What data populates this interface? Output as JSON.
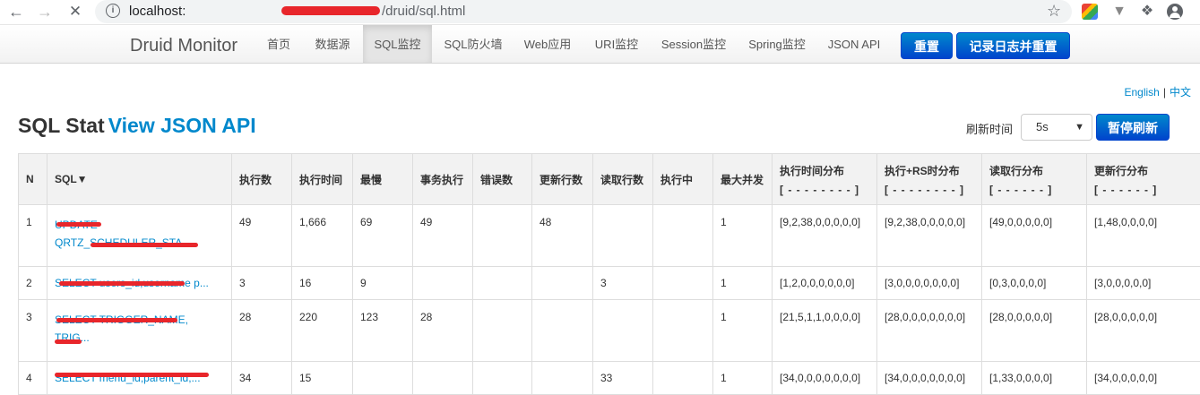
{
  "browser": {
    "url_host": "localhost:",
    "url_path": "/druid/sql.html"
  },
  "navbar": {
    "brand": "Druid Monitor",
    "items": [
      "首页",
      "数据源",
      "SQL监控",
      "SQL防火墙",
      "Web应用",
      "URI监控",
      "Session监控",
      "Spring监控",
      "JSON API"
    ],
    "active": "SQL监控",
    "reset_label": "重置",
    "log_reset_label": "记录日志并重置"
  },
  "lang": {
    "english": "English",
    "chinese": "中文"
  },
  "title": {
    "main": "SQL Stat",
    "api_link": "View JSON API"
  },
  "refresh": {
    "label": "刷新时间",
    "selected": "5s",
    "pause_label": "暂停刷新"
  },
  "table": {
    "headers": [
      "N",
      "SQL▼",
      "执行数",
      "执行时间",
      "最慢",
      "事务执行",
      "错误数",
      "更新行数",
      "读取行数",
      "执行中",
      "最大并发",
      "执行时间分布",
      "执行+RS时分布",
      "读取行分布",
      "更新行分布"
    ],
    "header_subs": [
      "[ - - - - - - - - ]",
      "[ - - - - - - - - ]",
      "[ - - - - - - ]",
      "[ - - - - - - ]"
    ],
    "rows": [
      {
        "n": "1",
        "sql_line1": "UPDATE",
        "sql_line2": "QRTZ_SCHEDULER_STA...",
        "exec": "49",
        "time": "1,666",
        "slowest": "69",
        "tx": "49",
        "err": "",
        "upd": "48",
        "read": "",
        "running": "",
        "maxc": "1",
        "d1": "[9,2,38,0,0,0,0,0]",
        "d2": "[9,2,38,0,0,0,0,0]",
        "d3": "[49,0,0,0,0,0]",
        "d4": "[1,48,0,0,0,0]"
      },
      {
        "n": "2",
        "sql_line1": "SELECT users_id,username p...",
        "sql_line2": "",
        "exec": "3",
        "time": "16",
        "slowest": "9",
        "tx": "",
        "err": "",
        "upd": "",
        "read": "3",
        "running": "",
        "maxc": "1",
        "d1": "[1,2,0,0,0,0,0,0]",
        "d2": "[3,0,0,0,0,0,0,0]",
        "d3": "[0,3,0,0,0,0]",
        "d4": "[3,0,0,0,0,0]"
      },
      {
        "n": "3",
        "sql_line1": "SELECT TRIGGER_NAME,",
        "sql_line2": "TRIG...",
        "exec": "28",
        "time": "220",
        "slowest": "123",
        "tx": "28",
        "err": "",
        "upd": "",
        "read": "",
        "running": "",
        "maxc": "1",
        "d1": "[21,5,1,1,0,0,0,0]",
        "d2": "[28,0,0,0,0,0,0,0]",
        "d3": "[28,0,0,0,0,0]",
        "d4": "[28,0,0,0,0,0]"
      },
      {
        "n": "4",
        "sql_line1": "SELECT menu_id,parent_id,...",
        "sql_line2": "",
        "exec": "34",
        "time": "15",
        "slowest": "",
        "tx": "",
        "err": "",
        "upd": "",
        "read": "33",
        "running": "",
        "maxc": "1",
        "d1": "[34,0,0,0,0,0,0,0]",
        "d2": "[34,0,0,0,0,0,0,0]",
        "d3": "[1,33,0,0,0,0]",
        "d4": "[34,0,0,0,0,0]"
      }
    ]
  }
}
